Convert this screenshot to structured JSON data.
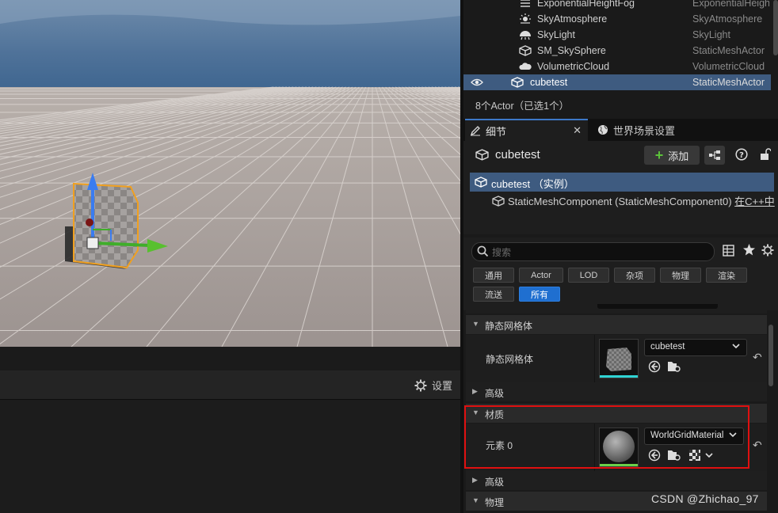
{
  "outliner": {
    "rows": [
      {
        "name": "ExponentialHeightFog",
        "type": "ExponentialHeightFog",
        "icon": "fog-icon",
        "selected": false
      },
      {
        "name": "SkyAtmosphere",
        "type": "SkyAtmosphere",
        "icon": "sky-atmosphere-icon",
        "selected": false
      },
      {
        "name": "SkyLight",
        "type": "SkyLight",
        "icon": "skylight-icon",
        "selected": false
      },
      {
        "name": "SM_SkySphere",
        "type": "StaticMeshActor",
        "icon": "static-mesh-icon",
        "selected": false
      },
      {
        "name": "VolumetricCloud",
        "type": "VolumetricCloud",
        "icon": "cloud-icon",
        "selected": false
      },
      {
        "name": "cubetest",
        "type": "StaticMeshActor",
        "icon": "static-mesh-icon",
        "selected": true
      }
    ],
    "count_text": "8个Actor（已选1个）"
  },
  "tabs": {
    "details": "细节",
    "world_settings": "世界场景设置"
  },
  "details": {
    "actor_name": "cubetest",
    "add_label": "添加",
    "tree_root": "cubetest （实例）",
    "tree_child": "StaticMeshComponent (StaticMeshComponent0)",
    "tree_child_link": "在C++中"
  },
  "search": {
    "placeholder": "搜索"
  },
  "filters": [
    {
      "label": "通用",
      "active": false
    },
    {
      "label": "Actor",
      "active": false
    },
    {
      "label": "LOD",
      "active": false
    },
    {
      "label": "杂项",
      "active": false
    },
    {
      "label": "物理",
      "active": false
    },
    {
      "label": "渲染",
      "active": false
    },
    {
      "label": "流送",
      "active": false
    },
    {
      "label": "所有",
      "active": true
    }
  ],
  "sections": {
    "static_mesh": {
      "header": "静态网格体",
      "prop_label": "静态网格体",
      "value": "cubetest"
    },
    "advanced_1": "高级",
    "materials": {
      "header": "材质",
      "prop_label": "元素 0",
      "value": "WorldGridMaterial"
    },
    "advanced_2": "高级",
    "physics": "物理"
  },
  "viewport": {
    "settings_label": "设置"
  },
  "watermark": "CSDN @Zhichao_97",
  "colors": {
    "selection": "#3e5b80",
    "accent": "#1f6fd0",
    "highlight": "#e01010"
  }
}
